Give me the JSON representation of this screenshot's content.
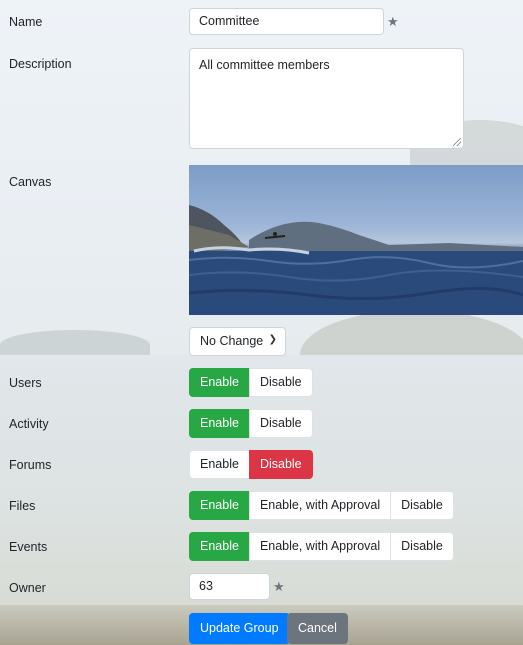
{
  "form": {
    "name": {
      "label": "Name",
      "value": "Committee",
      "star_icon": "star-icon"
    },
    "description": {
      "label": "Description",
      "value": "All committee members"
    },
    "canvas": {
      "label": "Canvas",
      "image_alt": "sea-kayak-photo"
    },
    "canvas_select": {
      "value": "No Change"
    },
    "users": {
      "label": "Users",
      "options": [
        "Enable",
        "Disable"
      ],
      "selected": "Enable"
    },
    "activity": {
      "label": "Activity",
      "options": [
        "Enable",
        "Disable"
      ],
      "selected": "Enable"
    },
    "forums": {
      "label": "Forums",
      "options": [
        "Enable",
        "Disable"
      ],
      "selected": "Disable"
    },
    "files": {
      "label": "Files",
      "options": [
        "Enable",
        "Enable, with Approval",
        "Disable"
      ],
      "selected": "Enable"
    },
    "events": {
      "label": "Events",
      "options": [
        "Enable",
        "Enable, with Approval",
        "Disable"
      ],
      "selected": "Enable"
    },
    "owner": {
      "label": "Owner",
      "value": "63",
      "star_icon": "star-icon"
    }
  },
  "actions": {
    "update": "Update Group",
    "cancel": "Cancel"
  },
  "colors": {
    "success": "#28a745",
    "danger": "#dc3545",
    "primary": "#007bff",
    "secondary": "#6c757d"
  }
}
